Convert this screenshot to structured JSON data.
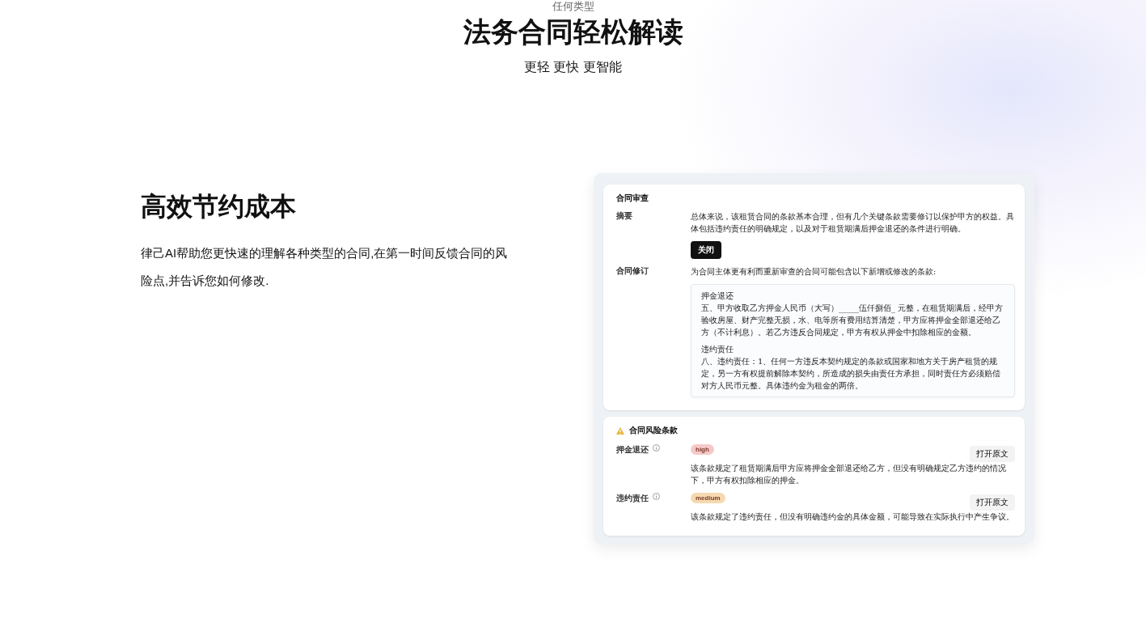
{
  "hero": {
    "eyebrow": "任何类型",
    "title": "法务合同轻松解读",
    "subtitle": "更轻 更快 更智能"
  },
  "feature": {
    "heading": "高效节约成本",
    "description": "律己AI帮助您更快速的理解各种类型的合同,在第一时间反馈合同的风险点,并告诉您如何修改."
  },
  "review": {
    "title": "合同审查",
    "summary_label": "摘要",
    "summary": "总体来说，该租赁合同的条款基本合理，但有几个关键条款需要修订以保护甲方的权益。具体包括违约责任的明确规定，以及对于租赁期满后押金退还的条件进行明确。",
    "close_button": "关闭",
    "revision_label": "合同修订",
    "revision_intro": "为合同主体更有利而重新审查的合同可能包含以下新增或修改的条款:",
    "clauses": [
      {
        "title": "押金退还",
        "text": "五、甲方收取乙方押金人民币（大写）_____伍仟捌佰_ 元整，在租赁期满后，经甲方验收房屋、财产完整无损，水、电等所有费用结算清楚，甲方应将押金全部退还给乙方（不计利息）。若乙方违反合同规定，甲方有权从押金中扣除相应的金额。"
      },
      {
        "title": "违约责任",
        "text": "八、违约责任：1、任何一方违反本契约规定的条款或国家和地方关于房产租赁的规定，另一方有权提前解除本契约，所造成的损失由责任方承担，同时责任方必须赔偿对方人民币元整。具体违约金为租金的两倍。"
      }
    ]
  },
  "risks": {
    "title": "合同风险条款",
    "items": [
      {
        "label": "押金退还",
        "level": "high",
        "color": "#f6c9c9",
        "button": "打开原文",
        "text": "该条款规定了租赁期满后甲方应将押金全部退还给乙方，但没有明确规定乙方违约的情况下，甲方有权扣除相应的押金。"
      },
      {
        "label": "违约责任",
        "level": "medium",
        "color": "#f6d9b0",
        "button": "打开原文",
        "text": "该条款规定了违约责任，但没有明确违约金的具体金额，可能导致在实际执行中产生争议。"
      }
    ]
  }
}
